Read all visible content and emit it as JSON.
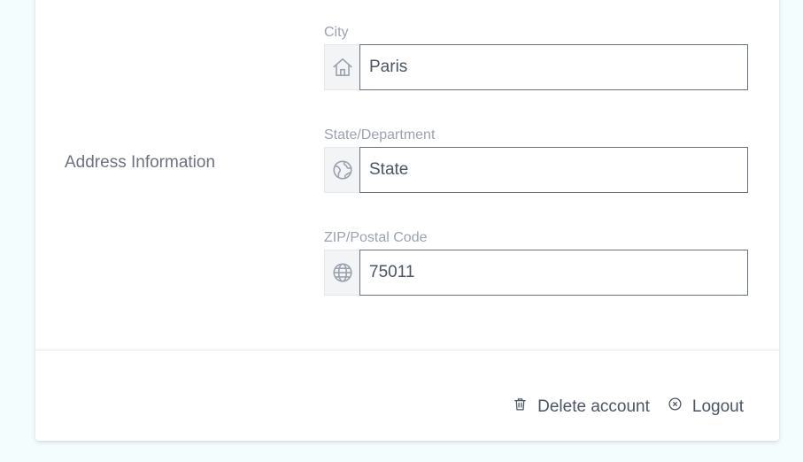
{
  "address_section": {
    "title": "Address Information",
    "city": {
      "label": "City",
      "value": "Paris",
      "icon": "home-icon"
    },
    "state": {
      "label": "State/Department",
      "placeholder": "State",
      "value": "",
      "icon": "globe-map-icon"
    },
    "zip": {
      "label": "ZIP/Postal Code",
      "value": "75011",
      "icon": "globe-icon"
    }
  },
  "actions": {
    "delete_label": "Delete account",
    "logout_label": "Logout"
  },
  "colors": {
    "background": "#f4fdfe",
    "card": "#ffffff",
    "text_muted": "#9ca3af",
    "text": "#4b5563",
    "addon_bg": "#f3f4f6"
  }
}
